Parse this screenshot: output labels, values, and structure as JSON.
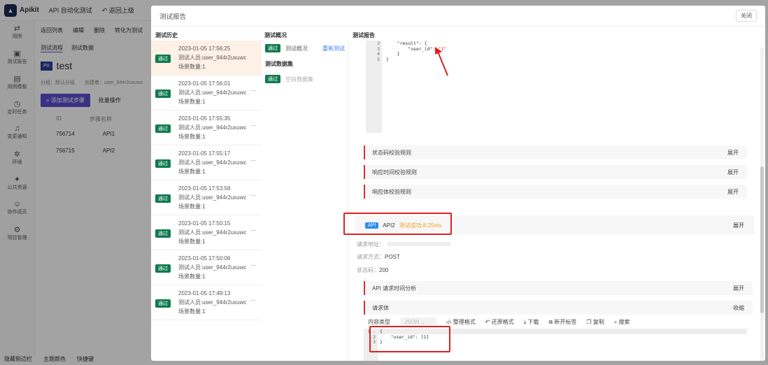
{
  "app": {
    "name": "Apikit",
    "module": "API 自动化测试",
    "back": "返回上级"
  },
  "sidebar": [
    {
      "icon": "swap-icon",
      "label": "用例"
    },
    {
      "icon": "report-icon",
      "label": "测试报告"
    },
    {
      "icon": "template-icon",
      "label": "用例模板"
    },
    {
      "icon": "timer-icon",
      "label": "定时任务"
    },
    {
      "icon": "bell-icon",
      "label": "变更通知"
    },
    {
      "icon": "environment-icon",
      "label": "环境"
    },
    {
      "icon": "puzzle-icon",
      "label": "公共资源"
    },
    {
      "icon": "users-icon",
      "label": "协作成员"
    },
    {
      "icon": "gear-icon",
      "label": "项目管理"
    }
  ],
  "bottom": [
    "隐藏侧边栏",
    "主题颜色",
    "快捷键"
  ],
  "page": {
    "actions": [
      "返回列表",
      "编辑",
      "删除",
      "转化为测试"
    ],
    "tabs": [
      "测试流程",
      "测试数据"
    ],
    "badge": "P0",
    "title": "test",
    "meta": "分组：默认分组",
    "creator": "创建者：user_944r2uxuwc",
    "add_step": "+ 添加测试步骤",
    "batch": "批量操作",
    "columns": [
      "ID",
      "步骤名称"
    ],
    "rows": [
      {
        "id": "756714",
        "name": "API1"
      },
      {
        "id": "756715",
        "name": "API2"
      }
    ]
  },
  "modal": {
    "title": "测试报告",
    "close": "关闭",
    "history_header": "测试历史",
    "overview_header": "测试概况",
    "report_header": "测试报告",
    "history": [
      {
        "status": "通过",
        "time": "2023-01-05 17:56:25",
        "tester": "测试人员:user_944r2uxuwc",
        "scenes": "场景数量:1"
      },
      {
        "status": "通过",
        "time": "2023-01-05 17:56:01",
        "tester": "测试人员:user_944r2uxuwc",
        "scenes": "场景数量:1"
      },
      {
        "status": "通过",
        "time": "2023-01-05 17:55:35",
        "tester": "测试人员:user_944r2uxuwc",
        "scenes": "场景数量:1"
      },
      {
        "status": "通过",
        "time": "2023-01-05 17:55:17",
        "tester": "测试人员:user_944r2uxuwc",
        "scenes": "场景数量:1"
      },
      {
        "status": "通过",
        "time": "2023-01-05 17:53:58",
        "tester": "测试人员:user_944r2uxuwc",
        "scenes": "场景数量:1"
      },
      {
        "status": "通过",
        "time": "2023-01-05 17:50:15",
        "tester": "测试人员:user_944r2uxuwc",
        "scenes": "场景数量:1"
      },
      {
        "status": "通过",
        "time": "2023-01-05 17:50:06",
        "tester": "测试人员:user_944r2uxuwc",
        "scenes": "场景数量:1"
      },
      {
        "status": "通过",
        "time": "2023-01-05 17:49:13",
        "tester": "测试人员:user_944r2uxuwc",
        "scenes": "场景数量:1"
      }
    ],
    "overview": {
      "status": "通过",
      "label": "测试概况",
      "rerun": "重新测试",
      "dataset_header": "测试数据集",
      "dataset_status": "通过",
      "dataset": "空白数据集"
    },
    "report": {
      "code1_lines": [
        "2",
        "3",
        "4",
        "5"
      ],
      "code1": [
        "    \"result\": {",
        "        \"user_id\": ",
        "    }",
        "}"
      ],
      "code1_value": "\"1\"",
      "sections": [
        {
          "label": "状态码校验规则",
          "action": "展开"
        },
        {
          "label": "响应时间校验规则",
          "action": "展开"
        },
        {
          "label": "响应体校验规则",
          "action": "展开"
        }
      ],
      "api_badge": "API",
      "api_name": "API2",
      "api_result": "测试成功,8.25ms",
      "api_action": "展开",
      "url_label": "请求地址：",
      "method_label": "请求方式：",
      "method": "POST",
      "status_label": "状态码：",
      "status": "200",
      "timing": {
        "label": "API 请求时间分析",
        "action": "展开"
      },
      "body": {
        "label": "请求体",
        "action": "收缩"
      },
      "toolbar": {
        "content_type": "内容类型",
        "type": "JSON",
        "format": "整理格式",
        "restore": "还原格式",
        "download": "下载",
        "new_tab": "新开标签",
        "copy": "复制",
        "search": "搜索"
      },
      "code2_lines": [
        "1 -",
        "2",
        "3"
      ],
      "code2": [
        "{",
        "    \"user_id\": [1]",
        "}"
      ]
    }
  }
}
